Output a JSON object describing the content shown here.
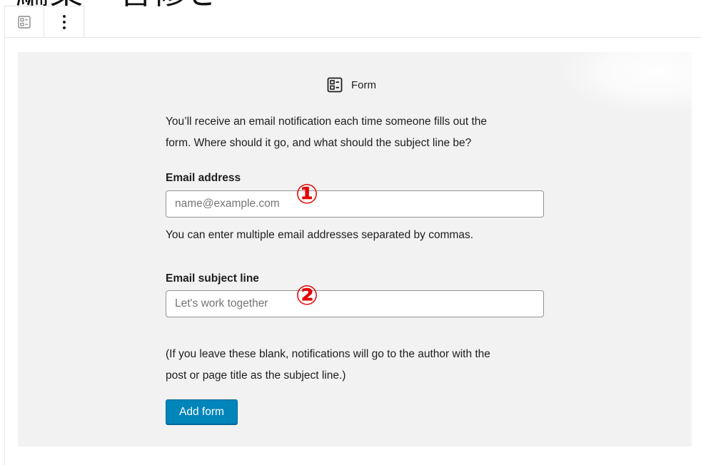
{
  "heading_fragment": "編集・管修き",
  "toolbar": {
    "block_type_icon": "form-icon",
    "more_options_icon": "more-vertical-icon"
  },
  "form_block": {
    "title": "Form",
    "title_icon": "form-icon",
    "description_line1": "You’ll receive an email notification each time someone fills out the",
    "description_line2": "form. Where should it go, and what should the subject line be?",
    "email_label": "Email address",
    "email_placeholder": "name@example.com",
    "email_value": "",
    "email_help": "You can enter multiple email addresses separated by commas.",
    "subject_label": "Email subject line",
    "subject_placeholder": "Let's work together",
    "subject_value": "",
    "note_line1": "(If you leave these blank, notifications will go to the author with the",
    "note_line2": "post or page title as the subject line.)",
    "add_button_label": "Add form"
  },
  "annotations": {
    "marker1": "①",
    "marker2": "②"
  },
  "colors": {
    "placeholder_bg": "#f2f2f2",
    "button_bg": "#0085ba",
    "marker": "#e60000"
  }
}
